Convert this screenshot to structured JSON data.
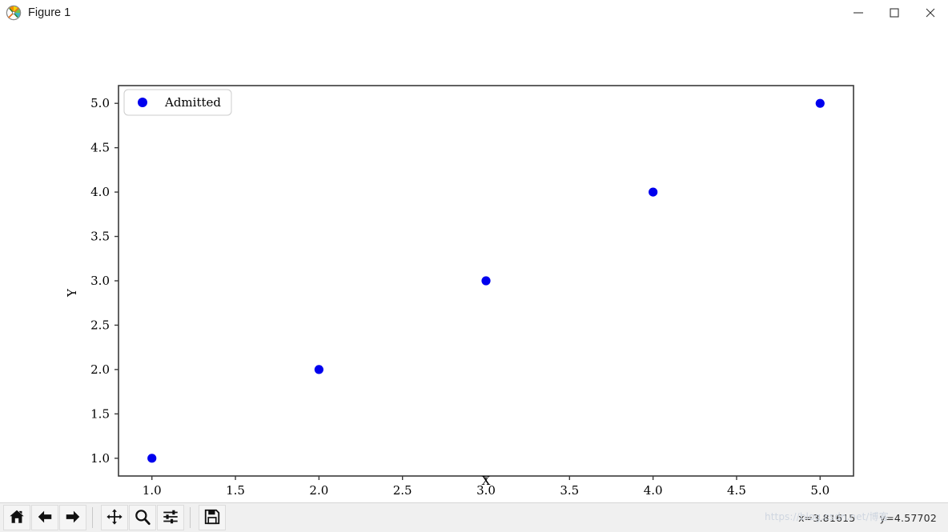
{
  "window": {
    "title": "Figure 1",
    "icon": "matplotlib-icon",
    "controls": {
      "minimize": "minimize-icon",
      "maximize": "maximize-icon",
      "close": "close-icon"
    }
  },
  "toolbar": {
    "buttons": [
      {
        "name": "home-button",
        "icon": "home-icon",
        "tooltip": "Reset original view"
      },
      {
        "name": "back-button",
        "icon": "arrow-left-icon",
        "tooltip": "Back to previous view"
      },
      {
        "name": "forward-button",
        "icon": "arrow-right-icon",
        "tooltip": "Forward to next view"
      },
      {
        "name": "pan-button",
        "icon": "move-icon",
        "tooltip": "Pan axes with left mouse, zoom with right"
      },
      {
        "name": "zoom-button",
        "icon": "magnifier-icon",
        "tooltip": "Zoom to rectangle"
      },
      {
        "name": "configure-subplots-button",
        "icon": "sliders-icon",
        "tooltip": "Configure subplots"
      },
      {
        "name": "save-button",
        "icon": "floppy-disk-icon",
        "tooltip": "Save the figure"
      }
    ],
    "coordinates": {
      "x": "x=3.81615",
      "y": "y=4.57702"
    },
    "watermark": "https://blog.csdn.net/博客"
  },
  "chart_data": {
    "type": "scatter",
    "title": "",
    "xlabel": "X",
    "ylabel": "Y",
    "xlim": [
      0.8,
      5.2
    ],
    "ylim": [
      0.8,
      5.2
    ],
    "xticks": [
      "1.0",
      "1.5",
      "2.0",
      "2.5",
      "3.0",
      "3.5",
      "4.0",
      "4.5",
      "5.0"
    ],
    "yticks": [
      "1.0",
      "1.5",
      "2.0",
      "2.5",
      "3.0",
      "3.5",
      "4.0",
      "4.5",
      "5.0"
    ],
    "xtick_values": [
      1.0,
      1.5,
      2.0,
      2.5,
      3.0,
      3.5,
      4.0,
      4.5,
      5.0
    ],
    "ytick_values": [
      1.0,
      1.5,
      2.0,
      2.5,
      3.0,
      3.5,
      4.0,
      4.5,
      5.0
    ],
    "grid": false,
    "legend_position": "upper left",
    "series": [
      {
        "name": "Admitted",
        "color": "#0000ee",
        "marker": "circle",
        "x": [
          1,
          2,
          3,
          4,
          5
        ],
        "y": [
          1,
          2,
          3,
          4,
          5
        ]
      }
    ]
  }
}
